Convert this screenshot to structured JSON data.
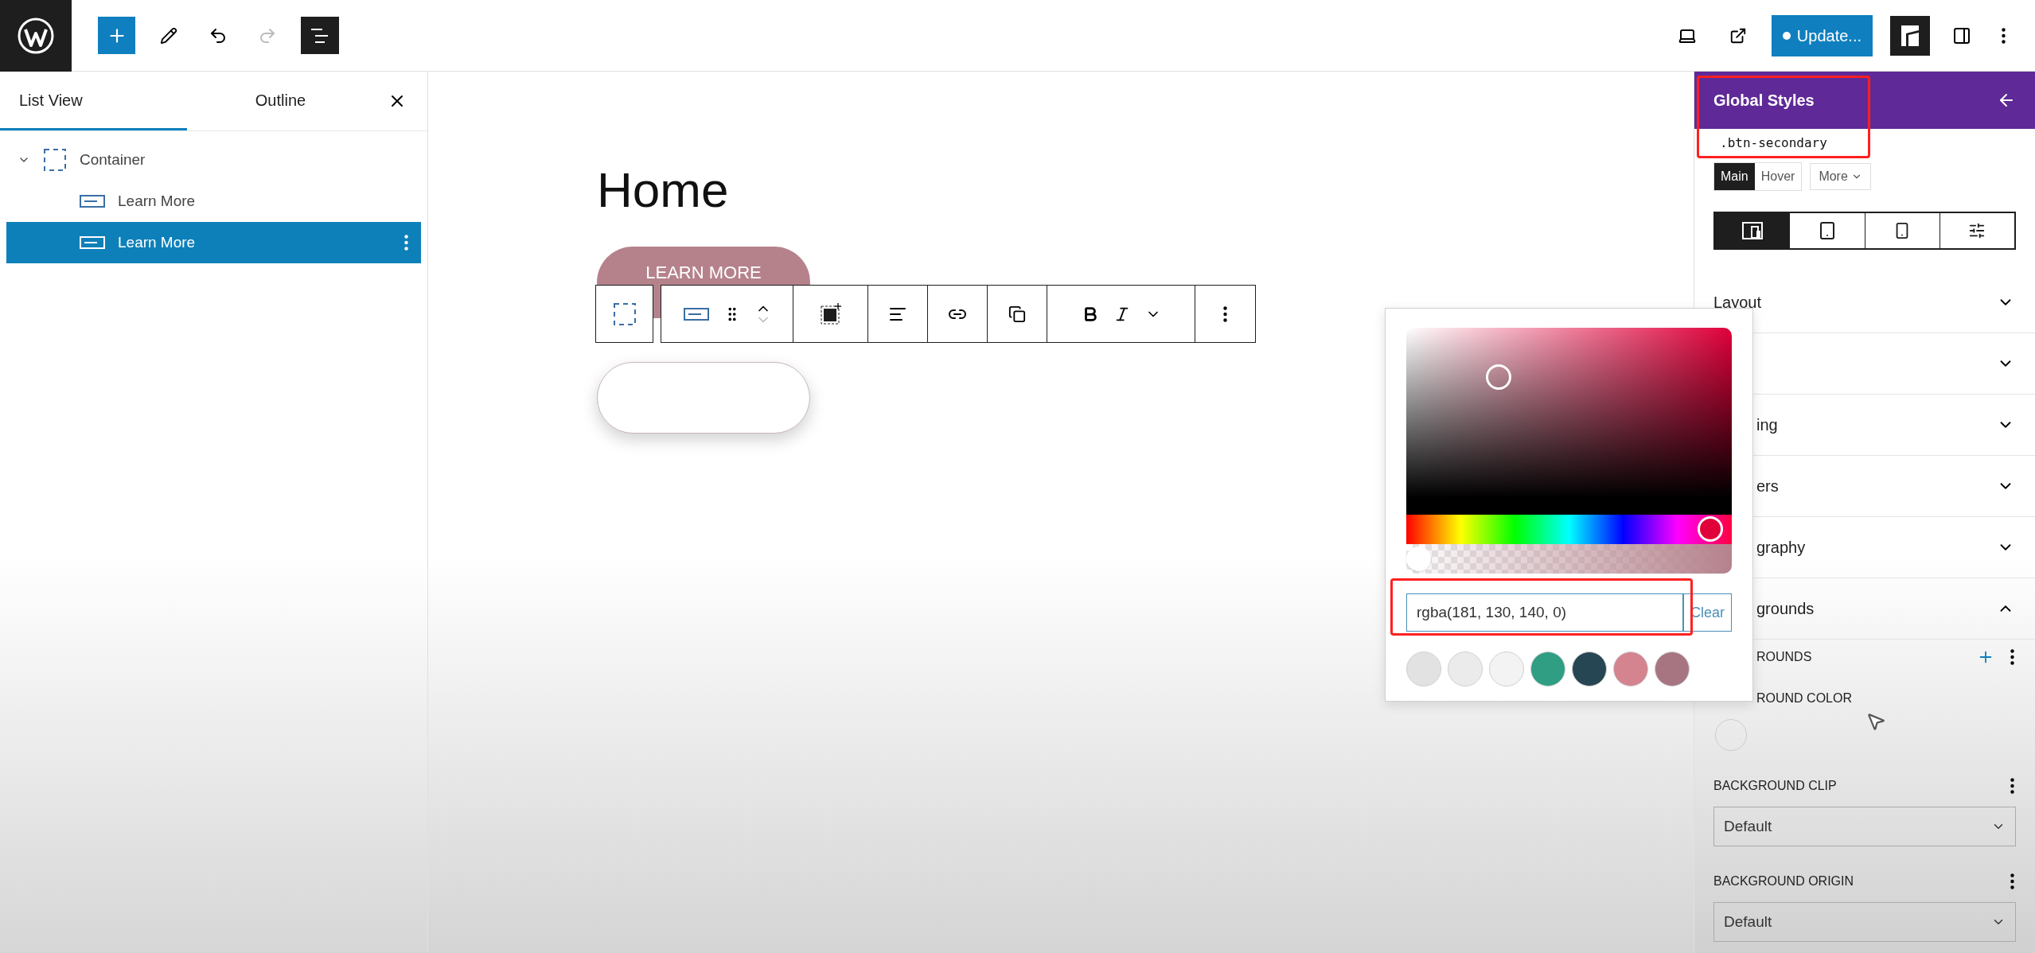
{
  "top_bar": {
    "redo": {
      "disabled": true
    },
    "list_view_toggle": {
      "pressed": true
    },
    "update_button": {
      "label": "Update..."
    }
  },
  "left_panel": {
    "tabs": [
      {
        "label": "List View",
        "selected": true
      },
      {
        "label": "Outline",
        "selected": false
      }
    ],
    "tree": [
      {
        "label": "Container",
        "kind": "container",
        "expanded": true,
        "selected": false,
        "children": [
          {
            "label": "Learn More",
            "kind": "button",
            "selected": false
          },
          {
            "label": "Learn More",
            "kind": "button",
            "selected": true
          }
        ]
      }
    ]
  },
  "canvas": {
    "heading": "Home",
    "buttons": [
      {
        "label": "LEARN MORE",
        "color": "#b5828c"
      },
      {
        "color": "#ffffff"
      }
    ]
  },
  "color_picker": {
    "hue": {
      "level": 0.97
    },
    "alpha": {
      "level": 0
    },
    "value": "rgba(181, 130, 140, 0)",
    "clear_button": "Clear",
    "swatches": [
      {
        "color": "#e2e2e2"
      },
      {
        "color": "#ebebeb"
      },
      {
        "color": "#f3f3f3"
      },
      {
        "color": "#2f9e82"
      },
      {
        "color": "#264653"
      },
      {
        "color": "#d4848f"
      },
      {
        "color": "#a77582"
      }
    ]
  },
  "right_panel": {
    "title": "Global Styles",
    "selector": ".btn-secondary",
    "state_tabs": [
      {
        "label": "Main",
        "selected": true
      },
      {
        "label": "Hover",
        "selected": false
      }
    ],
    "more_button": "More",
    "device_tabs": [
      {
        "kind": "desktop",
        "selected": true
      },
      {
        "kind": "tablet",
        "selected": false
      },
      {
        "kind": "mobile",
        "selected": false
      },
      {
        "kind": "settings",
        "selected": false
      }
    ],
    "sections": [
      {
        "label": "Layout",
        "expanded": false,
        "covered": false
      },
      {
        "expanded": false
      },
      {
        "label": "ing",
        "expanded": false,
        "covered": true
      },
      {
        "label": "ers",
        "expanded": false,
        "covered": true
      },
      {
        "label": "graphy",
        "expanded": false,
        "covered": true
      },
      {
        "label": "grounds",
        "expanded": true,
        "covered": true
      }
    ],
    "backgrounds": {
      "header": "ROUNDS",
      "color_label": "ROUND COLOR",
      "clip": {
        "label": "BACKGROUND CLIP",
        "value": "Default"
      },
      "origin": {
        "label": "BACKGROUND ORIGIN",
        "value": "Default"
      }
    }
  }
}
